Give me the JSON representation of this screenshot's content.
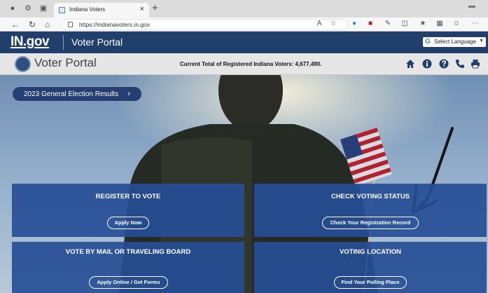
{
  "browser": {
    "tab_title": "Indiana Voters",
    "url": "https://indianavoters.in.gov"
  },
  "site": {
    "logo_text": "IN.gov",
    "portal_title": "Voter Portal",
    "language_label": "Select Language"
  },
  "subheader": {
    "title": "Voter Portal",
    "voter_count_text": "Current Total of Registered Indiana Voters: 4,677,490."
  },
  "hero": {
    "results_button": "2023 General Election Results"
  },
  "tiles": [
    {
      "title": "REGISTER TO VOTE",
      "action": "Apply Now"
    },
    {
      "title": "CHECK VOTING STATUS",
      "action": "Check Your Registration Record"
    },
    {
      "title": "VOTE BY MAIL OR TRAVELING BOARD",
      "action": "Apply Online / Get Forms"
    },
    {
      "title": "VOTING LOCATION",
      "action": "Find Your Polling Place"
    }
  ],
  "icons": {
    "header": [
      "home-icon",
      "info-icon",
      "help-icon",
      "phone-icon",
      "print-icon"
    ]
  },
  "colors": {
    "ingov_header": "#203f6d",
    "tile": "#264e96",
    "subheader": "#e6e6e6"
  }
}
